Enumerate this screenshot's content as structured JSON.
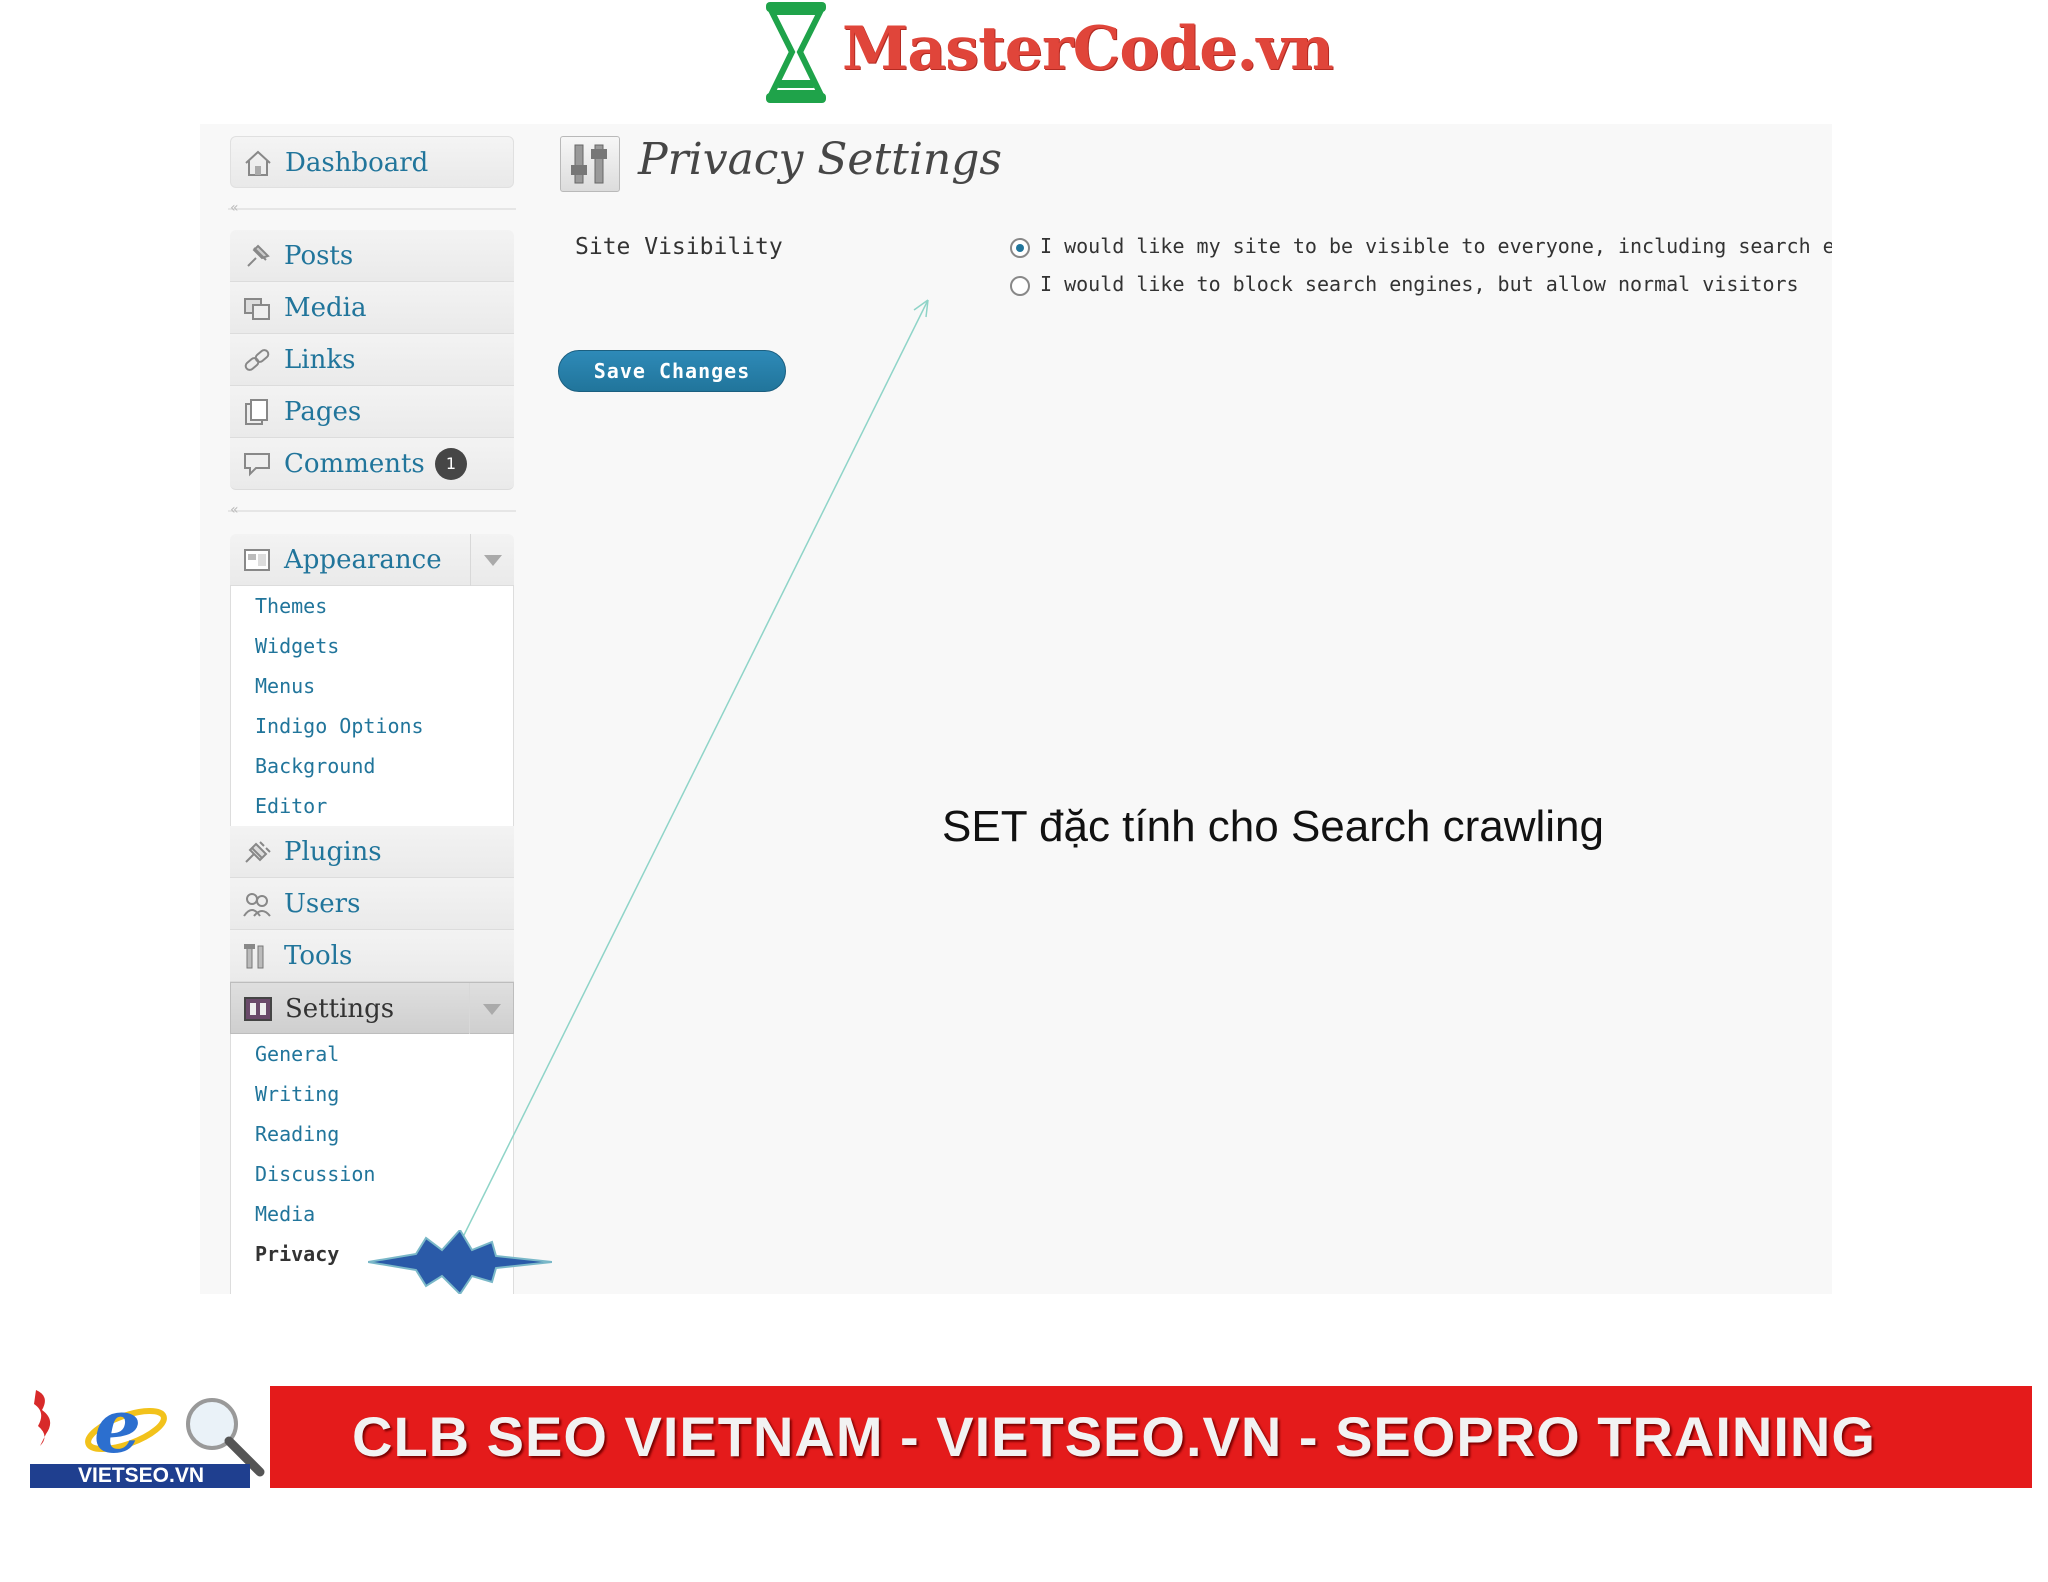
{
  "brand": {
    "name": "MasterCode.vn"
  },
  "sidebar": {
    "top_items": [
      {
        "label": "Dashboard",
        "icon": "dashboard-icon"
      }
    ],
    "content_items": [
      {
        "label": "Posts",
        "icon": "pin-icon"
      },
      {
        "label": "Media",
        "icon": "media-icon"
      },
      {
        "label": "Links",
        "icon": "link-icon"
      },
      {
        "label": "Pages",
        "icon": "pages-icon"
      },
      {
        "label": "Comments",
        "icon": "comment-icon",
        "badge": "1"
      }
    ],
    "appearance": {
      "label": "Appearance",
      "icon": "appearance-icon",
      "submenu": [
        "Themes",
        "Widgets",
        "Menus",
        "Indigo Options",
        "Background",
        "Editor"
      ]
    },
    "lower_items": [
      {
        "label": "Plugins",
        "icon": "plugin-icon"
      },
      {
        "label": "Users",
        "icon": "users-icon"
      },
      {
        "label": "Tools",
        "icon": "tools-icon"
      }
    ],
    "settings": {
      "label": "Settings",
      "icon": "settings-icon",
      "submenu": [
        "General",
        "Writing",
        "Reading",
        "Discussion",
        "Media",
        "Privacy"
      ],
      "current": "Privacy"
    }
  },
  "main": {
    "title": "Privacy Settings",
    "field_label": "Site Visibility",
    "options": [
      {
        "label": "I would like my site to be visible to everyone, including search engines",
        "checked": true
      },
      {
        "label": "I would like to block search engines, but allow normal visitors",
        "checked": false
      }
    ],
    "save_label": "Save Changes"
  },
  "annotation": {
    "caption": "SET đặc tính cho Search crawling"
  },
  "footer": {
    "logo_text": "VIETSEO.VN",
    "banner": "CLB SEO VIETNAM - VIETSEO.VN - SEOPRO TRAINING"
  },
  "colors": {
    "link": "#21759b",
    "banner_red": "#e41b1b",
    "brand_red": "#e0453a",
    "hourglass_green": "#1fa34a"
  }
}
